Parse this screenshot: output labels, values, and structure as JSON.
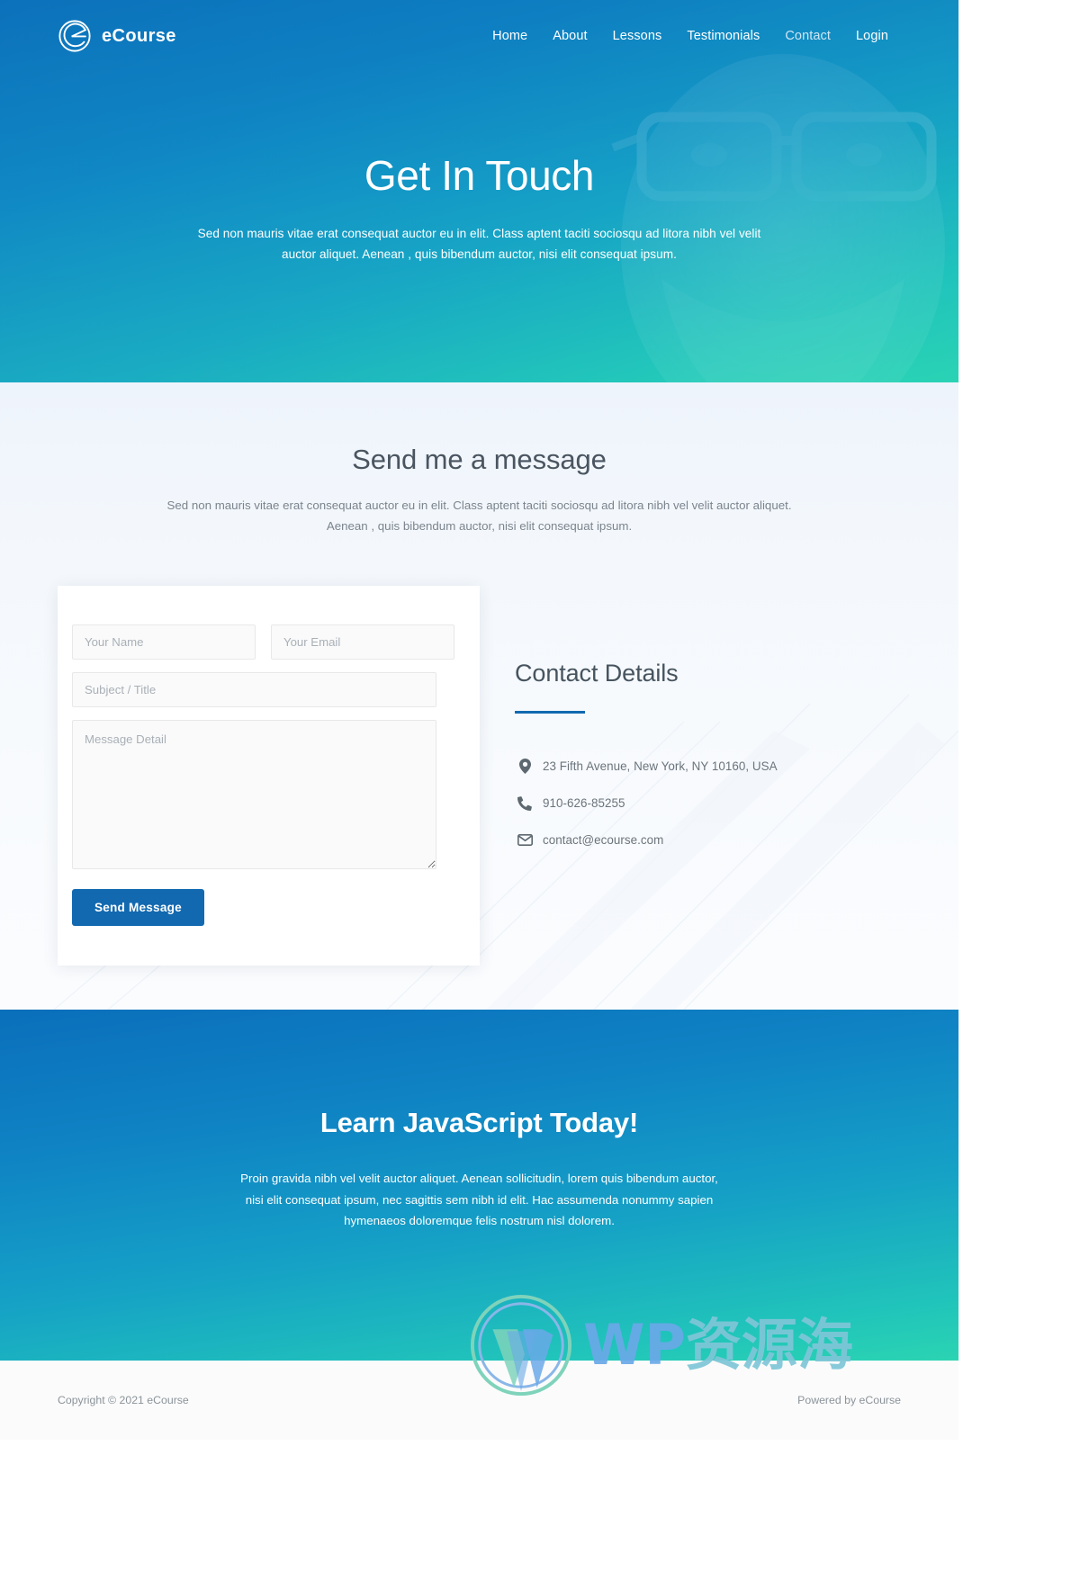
{
  "brand": {
    "name": "eCourse",
    "logo_icon": "ecourse-e-logo"
  },
  "nav": {
    "items": [
      {
        "label": "Home",
        "active": false
      },
      {
        "label": "About",
        "active": false
      },
      {
        "label": "Lessons",
        "active": false
      },
      {
        "label": "Testimonials",
        "active": false
      },
      {
        "label": "Contact",
        "active": true
      },
      {
        "label": "Login",
        "active": false
      }
    ]
  },
  "hero": {
    "title": "Get In Touch",
    "subtitle": "Sed non mauris vitae erat consequat auctor eu in elit. Class aptent taciti sociosqu ad litora nibh vel velit auctor aliquet. Aenean , quis bibendum auctor, nisi elit consequat ipsum."
  },
  "message_section": {
    "title": "Send me a message",
    "subtitle": "Sed non mauris vitae erat consequat auctor eu in elit. Class aptent taciti sociosqu ad litora nibh vel velit auctor aliquet. Aenean , quis bibendum auctor, nisi elit consequat ipsum."
  },
  "form": {
    "name_placeholder": "Your Name",
    "name_value": "",
    "email_placeholder": "Your Email",
    "email_value": "",
    "subject_placeholder": "Subject / Title",
    "subject_value": "",
    "message_placeholder": "Message Detail",
    "message_value": "",
    "submit_label": "Send Message"
  },
  "contact_details": {
    "title": "Contact Details",
    "items": [
      {
        "icon": "map-pin-icon",
        "text": "23 Fifth Avenue, New York, NY 10160, USA"
      },
      {
        "icon": "phone-icon",
        "text": "910-626-85255"
      },
      {
        "icon": "envelope-icon",
        "text": "contact@ecourse.com"
      }
    ]
  },
  "cta": {
    "title": "Learn JavaScript Today!",
    "text": "Proin gravida nibh vel velit auctor aliquet. Aenean sollicitudin, lorem quis bibendum auctor, nisi elit consequat ipsum, nec sagittis sem nibh id elit. Hac assumenda nonummy sapien hymenaeos doloremque felis nostrum nisl dolorem."
  },
  "footer": {
    "copyright": "Copyright © 2021 eCourse",
    "powered": "Powered by eCourse"
  },
  "watermark": {
    "text_latin": "WP",
    "text_cn": "资源海"
  },
  "colors": {
    "accent_blue": "#1269b0",
    "gradient_start": "#0a6fbb",
    "gradient_end": "#2bd4b2",
    "nav_active": "#cfe6f4"
  }
}
